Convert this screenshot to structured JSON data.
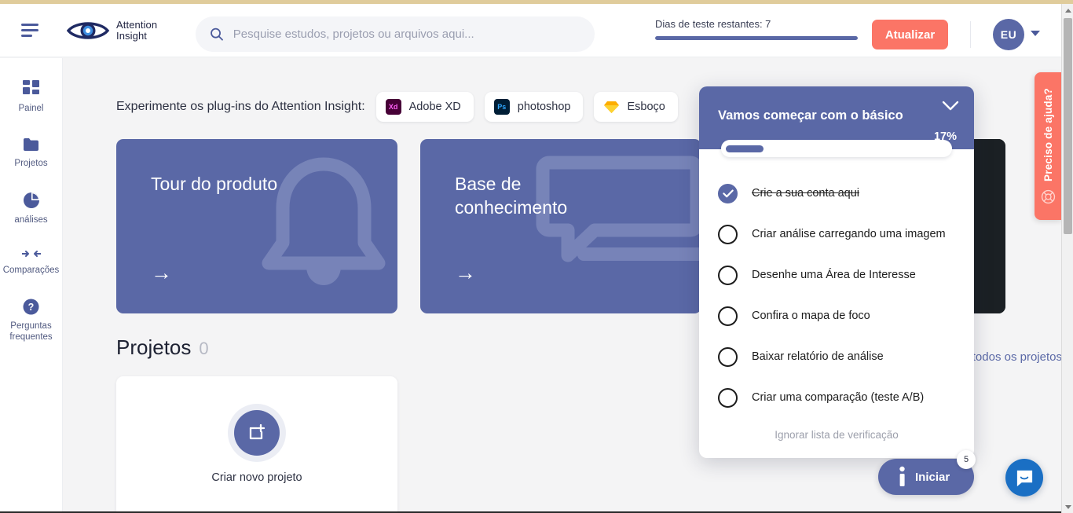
{
  "header": {
    "menu_icon": "hamburger-icon",
    "logo_line1": "Attention",
    "logo_line2": "Insight",
    "search_placeholder": "Pesquise estudos, projetos ou arquivos aqui...",
    "search_value": "",
    "search_icon": "search-icon",
    "trial_label": "Dias de teste restantes: 7",
    "trial_progress_pct": 100,
    "upgrade_label": "Atualizar",
    "avatar_initials": "EU",
    "accent_red": "#fb7566",
    "accent_blue": "#5a68a6"
  },
  "sidebar": {
    "items": [
      {
        "label": "Painel",
        "icon": "grid-icon"
      },
      {
        "label": "Projetos",
        "icon": "folder-icon"
      },
      {
        "label": "análises",
        "icon": "pie-chart-icon"
      },
      {
        "label": "Comparações",
        "icon": "compare-arrows-icon"
      },
      {
        "label": "Perguntas frequentes",
        "icon": "question-circle-icon"
      }
    ]
  },
  "plugins": {
    "label": "Experimente os plug-ins do Attention Insight:",
    "items": [
      {
        "name": "Adobe XD",
        "badge": "Xd",
        "badge_bg": "#470137",
        "badge_fg": "#ff61f6"
      },
      {
        "name": "photoshop",
        "badge": "Ps",
        "badge_bg": "#001e36",
        "badge_fg": "#31a8ff"
      },
      {
        "name": "Esboço",
        "badge": "sketch-diamond-icon",
        "badge_bg": "#ffffff",
        "badge_fg": "#fdad00"
      }
    ]
  },
  "cards": [
    {
      "title": "Tour do produto",
      "arrow": "→",
      "deco": "bell-icon"
    },
    {
      "title": "Base de conhecimento",
      "arrow": "→",
      "deco": "chat-icon"
    },
    {
      "title": "",
      "arrow": "",
      "deco": "dark-stripes"
    }
  ],
  "projects": {
    "title": "Projetos",
    "count": "0",
    "view_all_label": "Ver todos os projetos",
    "create_label": "Criar novo projeto",
    "create_icon": "add-file-icon"
  },
  "checklist": {
    "title": "Vamos começar com o básico",
    "percent_label": "17%",
    "percent_value": 17,
    "collapse_icon": "chevron-down-icon",
    "skip_label": "Ignorar lista de verificação",
    "items": [
      {
        "label": "Crie a sua conta aqui",
        "done": true
      },
      {
        "label": "Criar análise carregando uma imagem",
        "done": false
      },
      {
        "label": "Desenhe uma Área de Interesse",
        "done": false
      },
      {
        "label": "Confira o mapa de foco",
        "done": false
      },
      {
        "label": "Baixar relatório de análise",
        "done": false
      },
      {
        "label": "Criar uma comparação (teste A/B)",
        "done": false
      }
    ]
  },
  "help_tab": {
    "label": "Preciso de ajuda?",
    "icon": "lifebuoy-icon"
  },
  "launcher": {
    "label": "Iniciar",
    "icon": "info-icon",
    "badge_count": "5"
  },
  "intercom": {
    "icon": "messenger-icon"
  },
  "scrollbar": {
    "up_icon": "caret-up-icon",
    "down_icon": "caret-down-icon"
  }
}
